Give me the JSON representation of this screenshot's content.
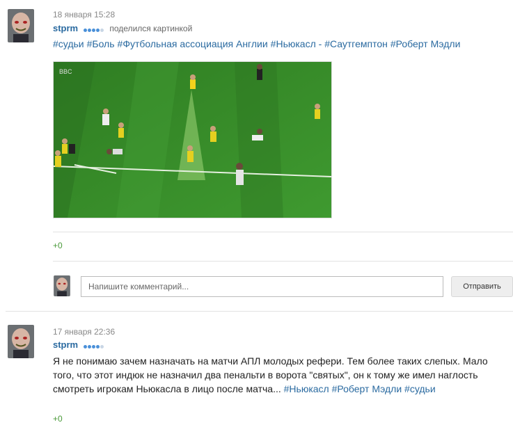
{
  "post1": {
    "date": "18 января 15:28",
    "username": "stprm",
    "rating_dots": {
      "filled": 4,
      "total": 5
    },
    "action": "поделился картинкой",
    "tags": [
      "#судьи",
      "#Боль",
      "#Футбольная ассоциация Англии",
      "#Ньюкасл - #Саутгемптон",
      "#Роберт Мэдли"
    ],
    "image_watermark": "BBC",
    "likes": "+0"
  },
  "comment_box": {
    "placeholder": "Напишите комментарий...",
    "send_label": "Отправить"
  },
  "post2": {
    "date": "17 января 22:36",
    "username": "stprm",
    "rating_dots": {
      "filled": 4,
      "total": 5
    },
    "text_lines": [
      "Я не понимаю зачем назначать на матчи АПЛ молодых рефери. Тем более таких слепых. Мало",
      "того, что этот индюк не назначил два пенальти в ворота \"святых\", он к тому же имел наглость",
      "смотреть игрокам Ньюкасла в лицо после матча..."
    ],
    "tags": [
      "#Ньюкасл",
      "#Роберт Мэдли",
      "#судьи"
    ],
    "likes": "+0"
  },
  "colors": {
    "link": "#2a6aa0",
    "green_counter": "#4a9a3a",
    "pitch_green": "#3a8a2a"
  }
}
